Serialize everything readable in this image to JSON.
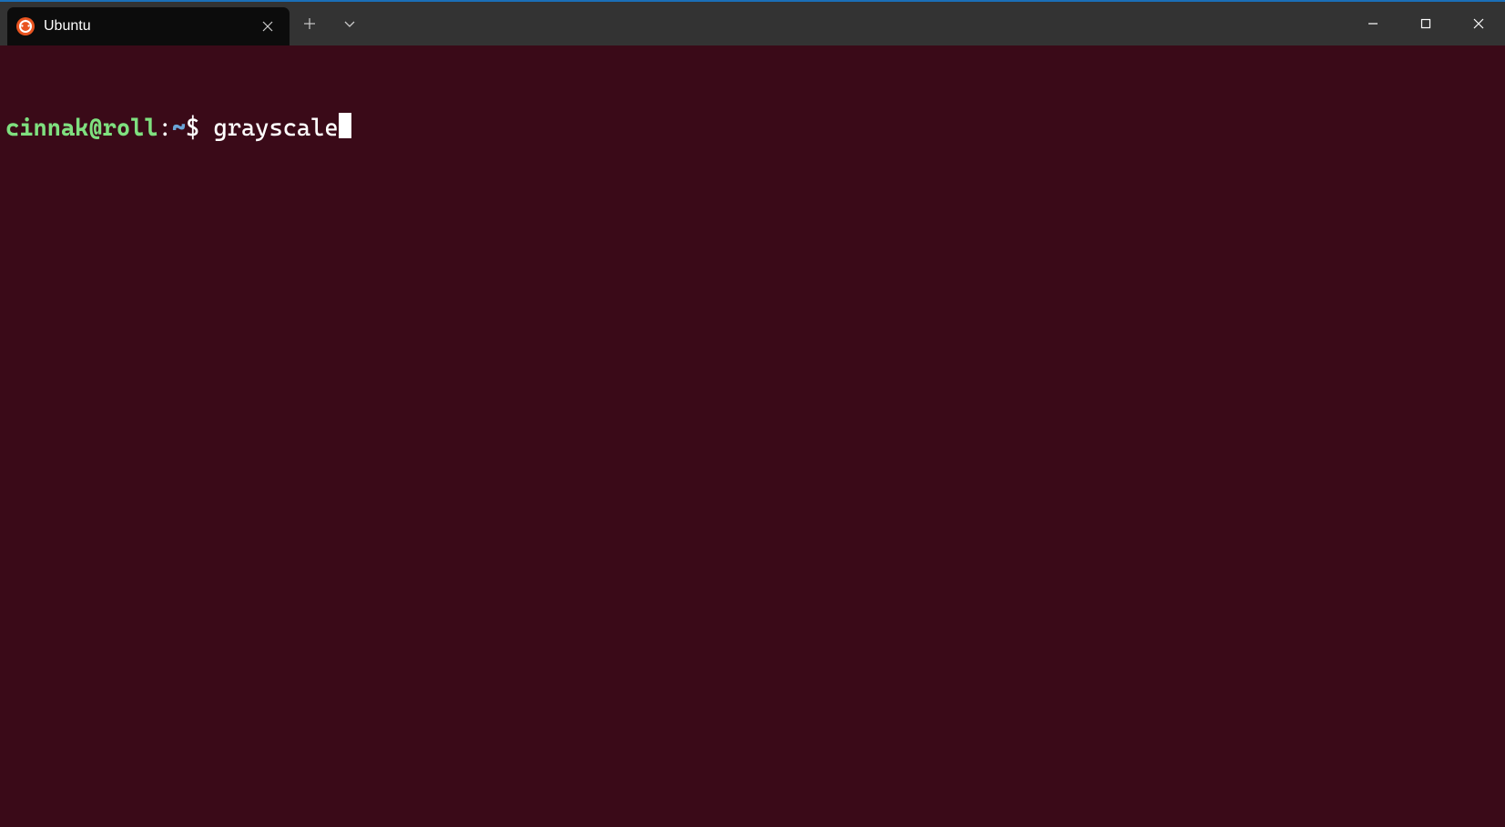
{
  "tab": {
    "title": "Ubuntu",
    "icon": "ubuntu-icon"
  },
  "prompt": {
    "user_host": "cinnak@roll",
    "separator": ":",
    "path": "~",
    "symbol": "$",
    "command": "grayscale"
  },
  "colors": {
    "terminal_bg": "#3a0a18",
    "titlebar_bg": "#333333",
    "tab_bg": "#0c0c0c",
    "prompt_user": "#7fe07f",
    "prompt_path": "#6aa5d8",
    "accent_top": "#1a6fb8"
  }
}
